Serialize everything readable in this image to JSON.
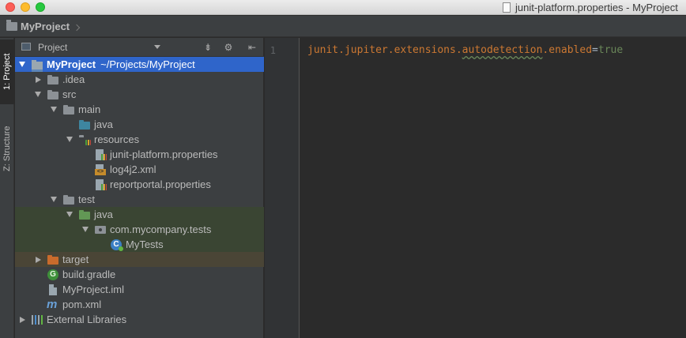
{
  "window": {
    "title": "junit-platform.properties - MyProject"
  },
  "navbar": {
    "crumb": "MyProject"
  },
  "tool_strip": {
    "tabs": [
      {
        "label": "1: Project",
        "active": true
      },
      {
        "label": "Z: Structure",
        "active": false
      }
    ]
  },
  "project_panel": {
    "title": "Project",
    "tree": [
      {
        "label": "MyProject",
        "path": "~/Projects/MyProject",
        "icon": "project-folder-icon",
        "expanded": true,
        "selected": true
      },
      {
        "label": ".idea",
        "icon": "folder-icon",
        "expanded": false
      },
      {
        "label": "src",
        "icon": "folder-icon",
        "expanded": true
      },
      {
        "label": "main",
        "icon": "folder-icon",
        "expanded": true
      },
      {
        "label": "java",
        "icon": "source-folder-icon"
      },
      {
        "label": "resources",
        "icon": "resources-folder-icon",
        "expanded": true
      },
      {
        "label": "junit-platform.properties",
        "icon": "properties-file-icon"
      },
      {
        "label": "log4j2.xml",
        "icon": "xml-file-icon"
      },
      {
        "label": "reportportal.properties",
        "icon": "properties-file-icon"
      },
      {
        "label": "test",
        "icon": "folder-icon",
        "expanded": true
      },
      {
        "label": "java",
        "icon": "test-source-folder-icon",
        "expanded": true
      },
      {
        "label": "com.mycompany.tests",
        "icon": "package-icon",
        "expanded": true
      },
      {
        "label": "MyTests",
        "icon": "class-icon"
      },
      {
        "label": "target",
        "icon": "excluded-folder-icon",
        "expanded": false
      },
      {
        "label": "build.gradle",
        "icon": "gradle-file-icon"
      },
      {
        "label": "MyProject.iml",
        "icon": "iml-file-icon"
      },
      {
        "label": "pom.xml",
        "icon": "maven-file-icon"
      },
      {
        "label": "External Libraries",
        "icon": "libraries-icon",
        "expanded": false
      }
    ]
  },
  "editor": {
    "line_number": "1",
    "tokens": {
      "key_prefix": "junit.jupiter.extensions.",
      "key_typo": "autodetection",
      "key_suffix": ".enabled",
      "equals": "=",
      "value": "true"
    }
  },
  "colors": {
    "selection": "#2f65ca",
    "keyword": "#cc7832",
    "string_value": "#6a8759",
    "panel_bg": "#3c3f41",
    "editor_bg": "#2b2b2b"
  }
}
